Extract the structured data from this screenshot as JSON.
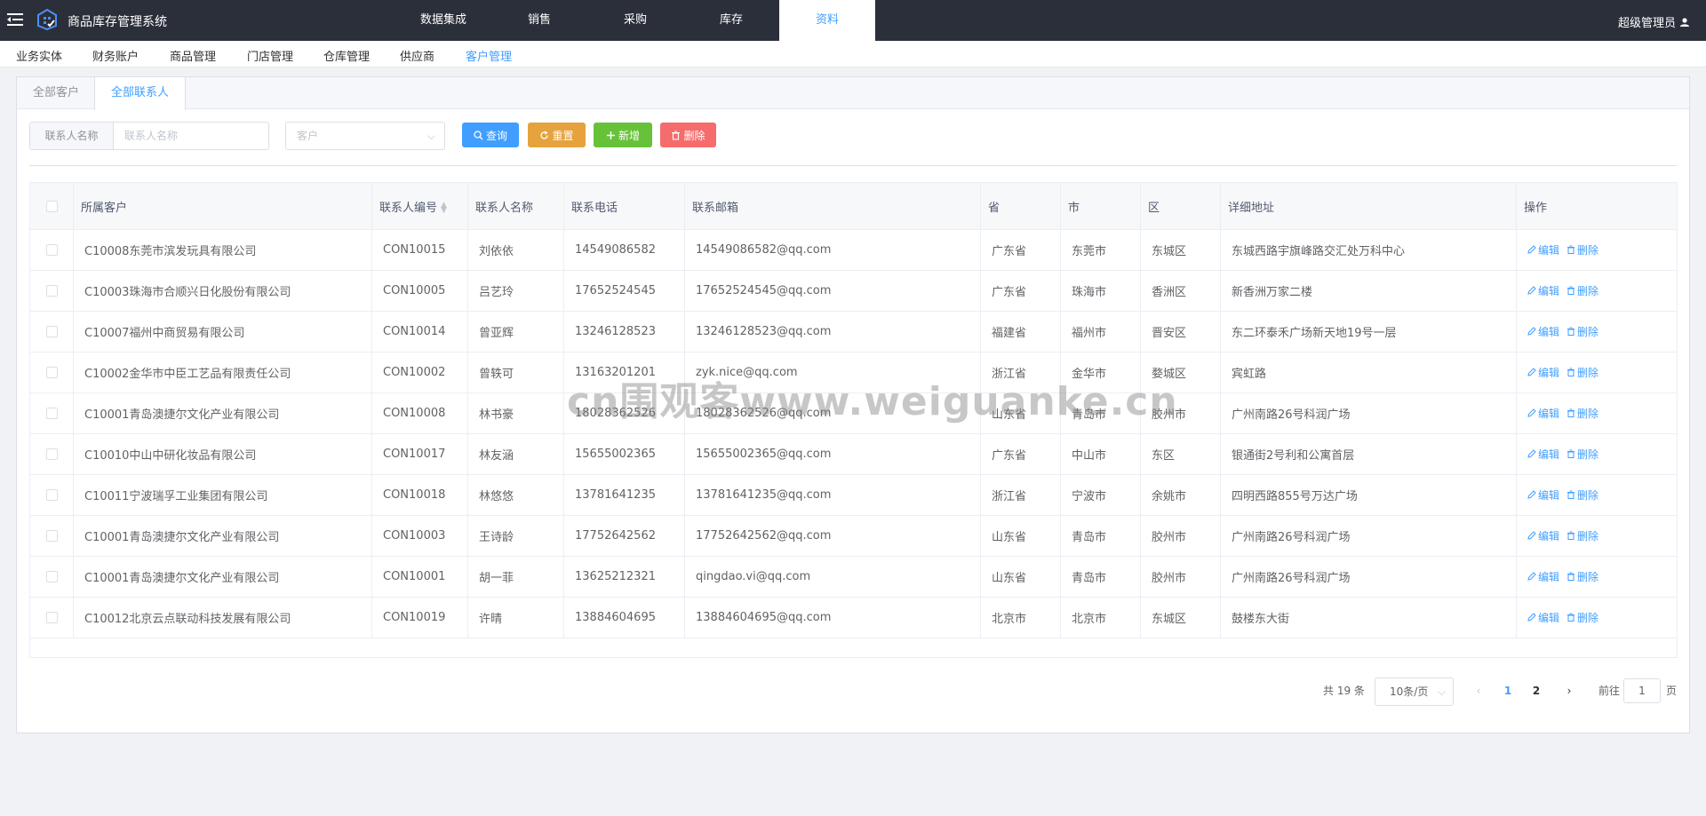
{
  "app": {
    "title": "商品库存管理系统",
    "user": "超级管理员"
  },
  "topnav": [
    "数据集成",
    "销售",
    "采购",
    "库存",
    "资料"
  ],
  "subnav": [
    "业务实体",
    "财务账户",
    "商品管理",
    "门店管理",
    "仓库管理",
    "供应商",
    "客户管理"
  ],
  "tabs": [
    "全部客户",
    "全部联系人"
  ],
  "filter": {
    "label": "联系人名称",
    "placeholder": "联系人名称",
    "customer_placeholder": "客户"
  },
  "buttons": {
    "query": "查询",
    "reset": "重置",
    "add": "新增",
    "delete": "删除"
  },
  "table": {
    "headers": [
      "所属客户",
      "联系人编号",
      "联系人名称",
      "联系电话",
      "联系邮箱",
      "省",
      "市",
      "区",
      "详细地址",
      "操作"
    ],
    "actions": {
      "edit": "编辑",
      "delete": "删除"
    },
    "rows": [
      [
        "C10008东莞市滨发玩具有限公司",
        "CON10015",
        "刘依依",
        "14549086582",
        "14549086582@qq.com",
        "广东省",
        "东莞市",
        "东城区",
        "东城西路宇旗峰路交汇处万科中心"
      ],
      [
        "C10003珠海市合顺兴日化股份有限公司",
        "CON10005",
        "吕艺玲",
        "17652524545",
        "17652524545@qq.com",
        "广东省",
        "珠海市",
        "香洲区",
        "新香洲万家二楼"
      ],
      [
        "C10007福州中商贸易有限公司",
        "CON10014",
        "曾亚辉",
        "13246128523",
        "13246128523@qq.com",
        "福建省",
        "福州市",
        "晋安区",
        "东二环泰禾广场新天地19号一层"
      ],
      [
        "C10002金华市中臣工艺品有限责任公司",
        "CON10002",
        "曾轶可",
        "13163201201",
        "zyk.nice@qq.com",
        "浙江省",
        "金华市",
        "婺城区",
        "宾虹路"
      ],
      [
        "C10001青岛澳捷尔文化产业有限公司",
        "CON10008",
        "林书豪",
        "18028362526",
        "18028362526@qq.com",
        "山东省",
        "青岛市",
        "胶州市",
        "广州南路26号科润广场"
      ],
      [
        "C10010中山中研化妆品有限公司",
        "CON10017",
        "林友涵",
        "15655002365",
        "15655002365@qq.com",
        "广东省",
        "中山市",
        "东区",
        "银通街2号利和公寓首层"
      ],
      [
        "C10011宁波瑞孚工业集团有限公司",
        "CON10018",
        "林悠悠",
        "13781641235",
        "13781641235@qq.com",
        "浙江省",
        "宁波市",
        "余姚市",
        "四明西路855号万达广场"
      ],
      [
        "C10001青岛澳捷尔文化产业有限公司",
        "CON10003",
        "王诗龄",
        "17752642562",
        "17752642562@qq.com",
        "山东省",
        "青岛市",
        "胶州市",
        "广州南路26号科润广场"
      ],
      [
        "C10001青岛澳捷尔文化产业有限公司",
        "CON10001",
        "胡一菲",
        "13625212321",
        "qingdao.vi@qq.com",
        "山东省",
        "青岛市",
        "胶州市",
        "广州南路26号科润广场"
      ],
      [
        "C10012北京云点联动科技发展有限公司",
        "CON10019",
        "许晴",
        "13884604695",
        "13884604695@qq.com",
        "北京市",
        "北京市",
        "东城区",
        "鼓楼东大街"
      ]
    ]
  },
  "pagination": {
    "total": "共 19 条",
    "page_size": "10条/页",
    "pages": [
      "1",
      "2"
    ],
    "goto_label": "前往",
    "goto_value": "1",
    "goto_unit": "页"
  },
  "watermark": "cn围观客www.weiguanke.cn",
  "colors": {
    "primary": "#409eff",
    "warning": "#e6a23c",
    "success": "#67c23a",
    "danger": "#f56c6c",
    "topbar": "#2b2f3a"
  }
}
